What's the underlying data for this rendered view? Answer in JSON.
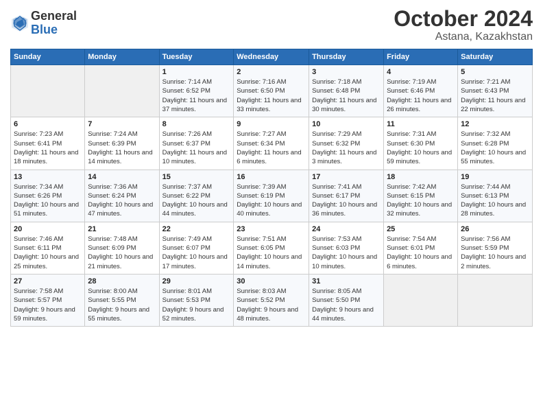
{
  "header": {
    "logo_general": "General",
    "logo_blue": "Blue",
    "month": "October 2024",
    "location": "Astana, Kazakhstan"
  },
  "days_of_week": [
    "Sunday",
    "Monday",
    "Tuesday",
    "Wednesday",
    "Thursday",
    "Friday",
    "Saturday"
  ],
  "weeks": [
    [
      {
        "day": "",
        "info": ""
      },
      {
        "day": "",
        "info": ""
      },
      {
        "day": "1",
        "sunrise": "7:14 AM",
        "sunset": "6:52 PM",
        "daylight": "11 hours and 37 minutes."
      },
      {
        "day": "2",
        "sunrise": "7:16 AM",
        "sunset": "6:50 PM",
        "daylight": "11 hours and 33 minutes."
      },
      {
        "day": "3",
        "sunrise": "7:18 AM",
        "sunset": "6:48 PM",
        "daylight": "11 hours and 30 minutes."
      },
      {
        "day": "4",
        "sunrise": "7:19 AM",
        "sunset": "6:46 PM",
        "daylight": "11 hours and 26 minutes."
      },
      {
        "day": "5",
        "sunrise": "7:21 AM",
        "sunset": "6:43 PM",
        "daylight": "11 hours and 22 minutes."
      }
    ],
    [
      {
        "day": "6",
        "sunrise": "7:23 AM",
        "sunset": "6:41 PM",
        "daylight": "11 hours and 18 minutes."
      },
      {
        "day": "7",
        "sunrise": "7:24 AM",
        "sunset": "6:39 PM",
        "daylight": "11 hours and 14 minutes."
      },
      {
        "day": "8",
        "sunrise": "7:26 AM",
        "sunset": "6:37 PM",
        "daylight": "11 hours and 10 minutes."
      },
      {
        "day": "9",
        "sunrise": "7:27 AM",
        "sunset": "6:34 PM",
        "daylight": "11 hours and 6 minutes."
      },
      {
        "day": "10",
        "sunrise": "7:29 AM",
        "sunset": "6:32 PM",
        "daylight": "11 hours and 3 minutes."
      },
      {
        "day": "11",
        "sunrise": "7:31 AM",
        "sunset": "6:30 PM",
        "daylight": "10 hours and 59 minutes."
      },
      {
        "day": "12",
        "sunrise": "7:32 AM",
        "sunset": "6:28 PM",
        "daylight": "10 hours and 55 minutes."
      }
    ],
    [
      {
        "day": "13",
        "sunrise": "7:34 AM",
        "sunset": "6:26 PM",
        "daylight": "10 hours and 51 minutes."
      },
      {
        "day": "14",
        "sunrise": "7:36 AM",
        "sunset": "6:24 PM",
        "daylight": "10 hours and 47 minutes."
      },
      {
        "day": "15",
        "sunrise": "7:37 AM",
        "sunset": "6:22 PM",
        "daylight": "10 hours and 44 minutes."
      },
      {
        "day": "16",
        "sunrise": "7:39 AM",
        "sunset": "6:19 PM",
        "daylight": "10 hours and 40 minutes."
      },
      {
        "day": "17",
        "sunrise": "7:41 AM",
        "sunset": "6:17 PM",
        "daylight": "10 hours and 36 minutes."
      },
      {
        "day": "18",
        "sunrise": "7:42 AM",
        "sunset": "6:15 PM",
        "daylight": "10 hours and 32 minutes."
      },
      {
        "day": "19",
        "sunrise": "7:44 AM",
        "sunset": "6:13 PM",
        "daylight": "10 hours and 28 minutes."
      }
    ],
    [
      {
        "day": "20",
        "sunrise": "7:46 AM",
        "sunset": "6:11 PM",
        "daylight": "10 hours and 25 minutes."
      },
      {
        "day": "21",
        "sunrise": "7:48 AM",
        "sunset": "6:09 PM",
        "daylight": "10 hours and 21 minutes."
      },
      {
        "day": "22",
        "sunrise": "7:49 AM",
        "sunset": "6:07 PM",
        "daylight": "10 hours and 17 minutes."
      },
      {
        "day": "23",
        "sunrise": "7:51 AM",
        "sunset": "6:05 PM",
        "daylight": "10 hours and 14 minutes."
      },
      {
        "day": "24",
        "sunrise": "7:53 AM",
        "sunset": "6:03 PM",
        "daylight": "10 hours and 10 minutes."
      },
      {
        "day": "25",
        "sunrise": "7:54 AM",
        "sunset": "6:01 PM",
        "daylight": "10 hours and 6 minutes."
      },
      {
        "day": "26",
        "sunrise": "7:56 AM",
        "sunset": "5:59 PM",
        "daylight": "10 hours and 2 minutes."
      }
    ],
    [
      {
        "day": "27",
        "sunrise": "7:58 AM",
        "sunset": "5:57 PM",
        "daylight": "9 hours and 59 minutes."
      },
      {
        "day": "28",
        "sunrise": "8:00 AM",
        "sunset": "5:55 PM",
        "daylight": "9 hours and 55 minutes."
      },
      {
        "day": "29",
        "sunrise": "8:01 AM",
        "sunset": "5:53 PM",
        "daylight": "9 hours and 52 minutes."
      },
      {
        "day": "30",
        "sunrise": "8:03 AM",
        "sunset": "5:52 PM",
        "daylight": "9 hours and 48 minutes."
      },
      {
        "day": "31",
        "sunrise": "8:05 AM",
        "sunset": "5:50 PM",
        "daylight": "9 hours and 44 minutes."
      },
      {
        "day": "",
        "info": ""
      },
      {
        "day": "",
        "info": ""
      }
    ]
  ]
}
